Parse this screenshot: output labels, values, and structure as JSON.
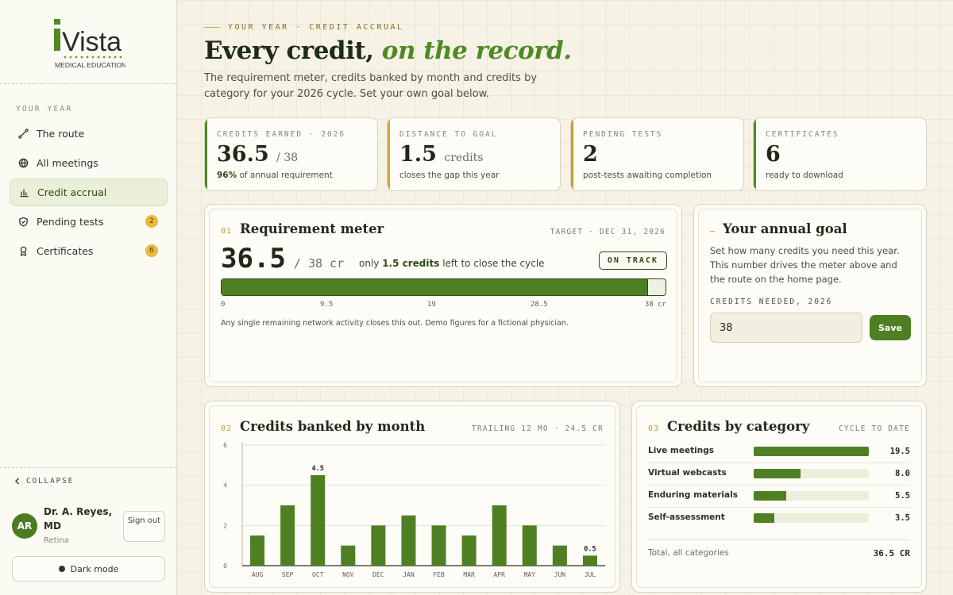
{
  "brand": {
    "logo_text": "Vista",
    "logo_sub": "MEDICAL EDUCATION"
  },
  "sidebar": {
    "section_label": "YOUR YEAR",
    "items": [
      {
        "label": "The route",
        "icon": "route-icon",
        "active": false
      },
      {
        "label": "All meetings",
        "icon": "globe-icon",
        "active": false
      },
      {
        "label": "Credit accrual",
        "icon": "bar-chart-icon",
        "active": true
      },
      {
        "label": "Pending tests",
        "icon": "shield-check-icon",
        "active": false,
        "badge": "2"
      },
      {
        "label": "Certificates",
        "icon": "award-icon",
        "active": false,
        "badge": "6"
      }
    ],
    "collapse_label": "COLLAPSE",
    "user": {
      "initials": "AR",
      "name": "Dr. A. Reyes, MD",
      "specialty": "Retina"
    },
    "signout_label": "Sign out",
    "darkmode_label": "Dark mode"
  },
  "header": {
    "eyebrow": "YOUR YEAR · CREDIT ACCRUAL",
    "title_main": "Every credit,",
    "title_accent": "on the record.",
    "lede": "The requirement meter, credits banked by month and credits by category for your 2026 cycle. Set your own goal below."
  },
  "stats": [
    {
      "label": "CREDITS EARNED · 2026",
      "value": "36.5",
      "unit": "/ 38",
      "sub_bold": "96%",
      "sub": " of annual requirement",
      "accent": "#4f8a24"
    },
    {
      "label": "DISTANCE TO GOAL",
      "value": "1.5",
      "unit": "credits",
      "sub_bold": "",
      "sub": "closes the gap this year",
      "accent": "#d4a437"
    },
    {
      "label": "PENDING TESTS",
      "value": "2",
      "unit": "",
      "sub_bold": "",
      "sub": "post-tests awaiting completion",
      "accent": "#c99a2e"
    },
    {
      "label": "CERTIFICATES",
      "value": "6",
      "unit": "",
      "sub_bold": "",
      "sub": "ready to download",
      "accent": "#4f8a24"
    }
  ],
  "meter": {
    "num": "01",
    "title": "Requirement meter",
    "target": "TARGET · DEC 31, 2026",
    "value": "36.5",
    "of": "/ 38 cr",
    "note_pre": "only ",
    "note_bold": "1.5 credits",
    "note_post": " left to close the cycle",
    "status": "ON TRACK",
    "progress": 36.5,
    "max": 38,
    "ticks": [
      "0",
      "9.5",
      "19",
      "28.5",
      "38 cr"
    ],
    "footnote": "Any single remaining network activity closes this out. Demo figures for a fictional physician."
  },
  "goal": {
    "title": "Your annual goal",
    "desc": "Set how many credits you need this year. This number drives the meter above and the route on the home page.",
    "field_label": "CREDITS NEEDED, 2026",
    "field_value": "38",
    "save_label": "Save"
  },
  "monthly": {
    "num": "02",
    "title": "Credits banked by month",
    "meta": "TRAILING 12 MO · 24.5 CR",
    "yticks": [
      "0",
      "2",
      "4",
      "6"
    ]
  },
  "chart_data": {
    "type": "bar",
    "categories": [
      "AUG",
      "SEP",
      "OCT",
      "NOV",
      "DEC",
      "JAN",
      "FEB",
      "MAR",
      "APR",
      "MAY",
      "JUN",
      "JUL"
    ],
    "values": [
      1.5,
      3,
      4.5,
      1,
      2,
      2.5,
      2,
      1.5,
      3,
      2,
      1,
      0.5
    ],
    "data_labels": {
      "2": "4.5",
      "11": "0.5"
    },
    "ylim": [
      0,
      6
    ],
    "grid": true,
    "color": "#4f7f23"
  },
  "category": {
    "num": "03",
    "title": "Credits by category",
    "meta": "CYCLE TO DATE",
    "rows": [
      {
        "label": "Live meetings",
        "value": "19.5",
        "frac": 1.0
      },
      {
        "label": "Virtual webcasts",
        "value": "8.0",
        "frac": 0.41
      },
      {
        "label": "Enduring materials",
        "value": "5.5",
        "frac": 0.28
      },
      {
        "label": "Self-assessment",
        "value": "3.5",
        "frac": 0.18
      }
    ],
    "total_label": "Total, all categories",
    "total_value": "36.5 CR"
  }
}
